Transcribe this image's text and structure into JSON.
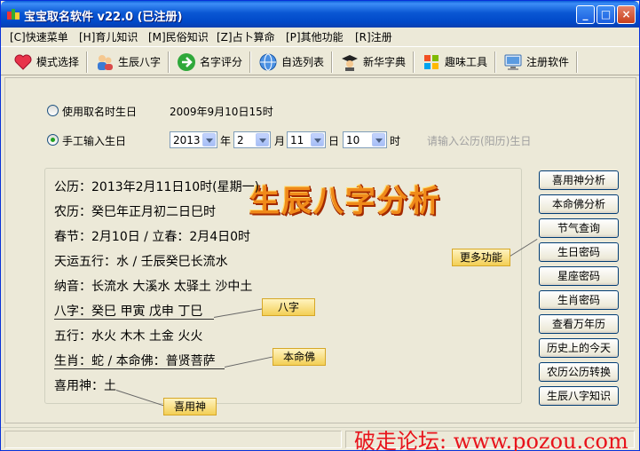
{
  "window": {
    "title": "宝宝取名软件 v22.0 (已注册)",
    "minimize": "_",
    "maximize": "□",
    "close": "×"
  },
  "menu": [
    "[C]快速菜单",
    "[H]育儿知识",
    "[M]民俗知识",
    "[Z]占卜算命",
    "[P]其他功能",
    "[R]注册"
  ],
  "toolbar": [
    {
      "label": "模式选择",
      "icon": "heart-icon"
    },
    {
      "label": "生辰八字",
      "icon": "people-icon"
    },
    {
      "label": "名字评分",
      "icon": "arrow-right-icon"
    },
    {
      "label": "自选列表",
      "icon": "globe-icon"
    },
    {
      "label": "新华字典",
      "icon": "scholar-icon"
    },
    {
      "label": "趣味工具",
      "icon": "windows-flag-icon"
    },
    {
      "label": "注册软件",
      "icon": "monitor-icon"
    }
  ],
  "birth": {
    "option_use": "使用取名时生日",
    "current_value": "2009年9月10日15时",
    "option_manual": "手工输入生日",
    "selected": "manual",
    "year": "2013",
    "year_unit": "年",
    "month": "2",
    "month_unit": "月",
    "day": "11",
    "day_unit": "日",
    "hour": "10",
    "hour_unit": "时",
    "hint": "请输入公历(阳历)生日"
  },
  "info": {
    "heading": "生辰八字分析",
    "lines": [
      "公历：2013年2月11日10时(星期一)",
      "农历：癸巳年正月初二日巳时",
      "春节：2月10日 / 立春：2月4日0时",
      "天运五行：水 / 壬辰癸巳长流水",
      "纳音：长流水 大溪水 太驿土 沙中土",
      "八字：癸巳 甲寅 戊申 丁巳",
      "五行：水火 木木 土金 火火",
      "生肖：蛇 / 本命佛：普贤菩萨",
      "喜用神：土"
    ],
    "tags": {
      "more": "更多功能",
      "bazi": "八字",
      "buddha": "本命佛",
      "xiyong": "喜用神"
    }
  },
  "side_buttons": [
    "喜用神分析",
    "本命佛分析",
    "节气查询",
    "生日密码",
    "星座密码",
    "生肖密码",
    "查看万年历",
    "历史上的今天",
    "农历公历转换",
    "生辰八字知识"
  ],
  "watermark": "破走论坛: www.pozou.com",
  "colors": {
    "title_bar": "#0a57d3",
    "heading": "#f08a1a",
    "watermark": "#e8141c",
    "tag_bg": "#f3cf55"
  }
}
